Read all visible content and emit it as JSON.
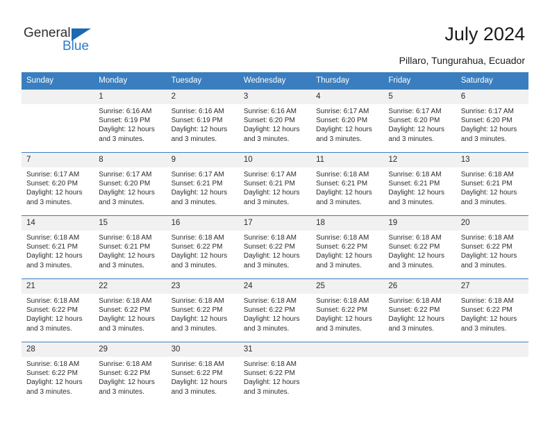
{
  "brand": {
    "name_primary": "General",
    "name_secondary": "Blue",
    "triangle_icon": "triangle-icon",
    "accent_color": "#2a7dc9",
    "header_color": "#3a7ebf"
  },
  "header": {
    "title": "July 2024",
    "subtitle": "Pillaro, Tungurahua, Ecuador"
  },
  "weekday_headers": [
    "Sunday",
    "Monday",
    "Tuesday",
    "Wednesday",
    "Thursday",
    "Friday",
    "Saturday"
  ],
  "weeks": [
    [
      {
        "day": "",
        "empty": true,
        "sunrise": "",
        "sunset": "",
        "daylight_1": "",
        "daylight_2": ""
      },
      {
        "day": "1",
        "sunrise": "Sunrise: 6:16 AM",
        "sunset": "Sunset: 6:19 PM",
        "daylight_1": "Daylight: 12 hours",
        "daylight_2": "and 3 minutes."
      },
      {
        "day": "2",
        "sunrise": "Sunrise: 6:16 AM",
        "sunset": "Sunset: 6:19 PM",
        "daylight_1": "Daylight: 12 hours",
        "daylight_2": "and 3 minutes."
      },
      {
        "day": "3",
        "sunrise": "Sunrise: 6:16 AM",
        "sunset": "Sunset: 6:20 PM",
        "daylight_1": "Daylight: 12 hours",
        "daylight_2": "and 3 minutes."
      },
      {
        "day": "4",
        "sunrise": "Sunrise: 6:17 AM",
        "sunset": "Sunset: 6:20 PM",
        "daylight_1": "Daylight: 12 hours",
        "daylight_2": "and 3 minutes."
      },
      {
        "day": "5",
        "sunrise": "Sunrise: 6:17 AM",
        "sunset": "Sunset: 6:20 PM",
        "daylight_1": "Daylight: 12 hours",
        "daylight_2": "and 3 minutes."
      },
      {
        "day": "6",
        "sunrise": "Sunrise: 6:17 AM",
        "sunset": "Sunset: 6:20 PM",
        "daylight_1": "Daylight: 12 hours",
        "daylight_2": "and 3 minutes."
      }
    ],
    [
      {
        "day": "7",
        "sunrise": "Sunrise: 6:17 AM",
        "sunset": "Sunset: 6:20 PM",
        "daylight_1": "Daylight: 12 hours",
        "daylight_2": "and 3 minutes."
      },
      {
        "day": "8",
        "sunrise": "Sunrise: 6:17 AM",
        "sunset": "Sunset: 6:20 PM",
        "daylight_1": "Daylight: 12 hours",
        "daylight_2": "and 3 minutes."
      },
      {
        "day": "9",
        "sunrise": "Sunrise: 6:17 AM",
        "sunset": "Sunset: 6:21 PM",
        "daylight_1": "Daylight: 12 hours",
        "daylight_2": "and 3 minutes."
      },
      {
        "day": "10",
        "sunrise": "Sunrise: 6:17 AM",
        "sunset": "Sunset: 6:21 PM",
        "daylight_1": "Daylight: 12 hours",
        "daylight_2": "and 3 minutes."
      },
      {
        "day": "11",
        "sunrise": "Sunrise: 6:18 AM",
        "sunset": "Sunset: 6:21 PM",
        "daylight_1": "Daylight: 12 hours",
        "daylight_2": "and 3 minutes."
      },
      {
        "day": "12",
        "sunrise": "Sunrise: 6:18 AM",
        "sunset": "Sunset: 6:21 PM",
        "daylight_1": "Daylight: 12 hours",
        "daylight_2": "and 3 minutes."
      },
      {
        "day": "13",
        "sunrise": "Sunrise: 6:18 AM",
        "sunset": "Sunset: 6:21 PM",
        "daylight_1": "Daylight: 12 hours",
        "daylight_2": "and 3 minutes."
      }
    ],
    [
      {
        "day": "14",
        "sunrise": "Sunrise: 6:18 AM",
        "sunset": "Sunset: 6:21 PM",
        "daylight_1": "Daylight: 12 hours",
        "daylight_2": "and 3 minutes."
      },
      {
        "day": "15",
        "sunrise": "Sunrise: 6:18 AM",
        "sunset": "Sunset: 6:21 PM",
        "daylight_1": "Daylight: 12 hours",
        "daylight_2": "and 3 minutes."
      },
      {
        "day": "16",
        "sunrise": "Sunrise: 6:18 AM",
        "sunset": "Sunset: 6:22 PM",
        "daylight_1": "Daylight: 12 hours",
        "daylight_2": "and 3 minutes."
      },
      {
        "day": "17",
        "sunrise": "Sunrise: 6:18 AM",
        "sunset": "Sunset: 6:22 PM",
        "daylight_1": "Daylight: 12 hours",
        "daylight_2": "and 3 minutes."
      },
      {
        "day": "18",
        "sunrise": "Sunrise: 6:18 AM",
        "sunset": "Sunset: 6:22 PM",
        "daylight_1": "Daylight: 12 hours",
        "daylight_2": "and 3 minutes."
      },
      {
        "day": "19",
        "sunrise": "Sunrise: 6:18 AM",
        "sunset": "Sunset: 6:22 PM",
        "daylight_1": "Daylight: 12 hours",
        "daylight_2": "and 3 minutes."
      },
      {
        "day": "20",
        "sunrise": "Sunrise: 6:18 AM",
        "sunset": "Sunset: 6:22 PM",
        "daylight_1": "Daylight: 12 hours",
        "daylight_2": "and 3 minutes."
      }
    ],
    [
      {
        "day": "21",
        "sunrise": "Sunrise: 6:18 AM",
        "sunset": "Sunset: 6:22 PM",
        "daylight_1": "Daylight: 12 hours",
        "daylight_2": "and 3 minutes."
      },
      {
        "day": "22",
        "sunrise": "Sunrise: 6:18 AM",
        "sunset": "Sunset: 6:22 PM",
        "daylight_1": "Daylight: 12 hours",
        "daylight_2": "and 3 minutes."
      },
      {
        "day": "23",
        "sunrise": "Sunrise: 6:18 AM",
        "sunset": "Sunset: 6:22 PM",
        "daylight_1": "Daylight: 12 hours",
        "daylight_2": "and 3 minutes."
      },
      {
        "day": "24",
        "sunrise": "Sunrise: 6:18 AM",
        "sunset": "Sunset: 6:22 PM",
        "daylight_1": "Daylight: 12 hours",
        "daylight_2": "and 3 minutes."
      },
      {
        "day": "25",
        "sunrise": "Sunrise: 6:18 AM",
        "sunset": "Sunset: 6:22 PM",
        "daylight_1": "Daylight: 12 hours",
        "daylight_2": "and 3 minutes."
      },
      {
        "day": "26",
        "sunrise": "Sunrise: 6:18 AM",
        "sunset": "Sunset: 6:22 PM",
        "daylight_1": "Daylight: 12 hours",
        "daylight_2": "and 3 minutes."
      },
      {
        "day": "27",
        "sunrise": "Sunrise: 6:18 AM",
        "sunset": "Sunset: 6:22 PM",
        "daylight_1": "Daylight: 12 hours",
        "daylight_2": "and 3 minutes."
      }
    ],
    [
      {
        "day": "28",
        "sunrise": "Sunrise: 6:18 AM",
        "sunset": "Sunset: 6:22 PM",
        "daylight_1": "Daylight: 12 hours",
        "daylight_2": "and 3 minutes."
      },
      {
        "day": "29",
        "sunrise": "Sunrise: 6:18 AM",
        "sunset": "Sunset: 6:22 PM",
        "daylight_1": "Daylight: 12 hours",
        "daylight_2": "and 3 minutes."
      },
      {
        "day": "30",
        "sunrise": "Sunrise: 6:18 AM",
        "sunset": "Sunset: 6:22 PM",
        "daylight_1": "Daylight: 12 hours",
        "daylight_2": "and 3 minutes."
      },
      {
        "day": "31",
        "sunrise": "Sunrise: 6:18 AM",
        "sunset": "Sunset: 6:22 PM",
        "daylight_1": "Daylight: 12 hours",
        "daylight_2": "and 3 minutes."
      },
      {
        "day": "",
        "empty": true,
        "sunrise": "",
        "sunset": "",
        "daylight_1": "",
        "daylight_2": ""
      },
      {
        "day": "",
        "empty": true,
        "sunrise": "",
        "sunset": "",
        "daylight_1": "",
        "daylight_2": ""
      },
      {
        "day": "",
        "empty": true,
        "sunrise": "",
        "sunset": "",
        "daylight_1": "",
        "daylight_2": ""
      }
    ]
  ]
}
